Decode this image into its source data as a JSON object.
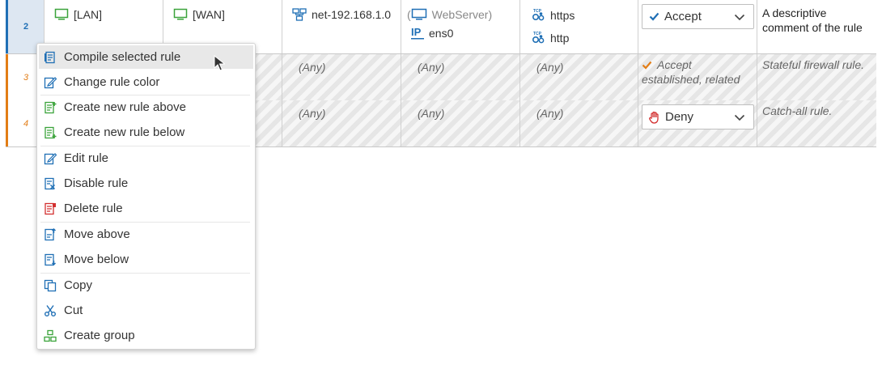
{
  "rows": [
    {
      "num": "2",
      "source": "[LAN]",
      "destination": "[WAN]",
      "network": "net-192.168.1.0",
      "host_prefix": "(",
      "host": "WebServer)",
      "interface": "ens0",
      "services": [
        "https",
        "http"
      ],
      "action": "Accept",
      "comment": "A descriptive comment of the rule"
    },
    {
      "num": "3",
      "any": [
        "(Any)",
        "(Any)",
        "(Any)"
      ],
      "action_line1": "Accept",
      "action_line2": "established, related",
      "comment": "Stateful firewall rule."
    },
    {
      "num": "4",
      "any": [
        "(Any)",
        "(Any)",
        "(Any)"
      ],
      "action": "Deny",
      "comment": "Catch-all rule."
    }
  ],
  "context_menu": {
    "items": [
      {
        "label": "Compile selected rule",
        "icon": "compile-icon"
      },
      {
        "label": "Change rule color",
        "icon": "edit-color-icon"
      },
      {
        "label": "Create new rule above",
        "icon": "rule-add-above-icon"
      },
      {
        "label": "Create new rule below",
        "icon": "rule-add-below-icon"
      },
      {
        "label": "Edit rule",
        "icon": "edit-icon"
      },
      {
        "label": "Disable rule",
        "icon": "disable-icon"
      },
      {
        "label": "Delete rule",
        "icon": "delete-icon"
      },
      {
        "label": "Move above",
        "icon": "move-up-icon"
      },
      {
        "label": "Move below",
        "icon": "move-down-icon"
      },
      {
        "label": "Copy",
        "icon": "copy-icon"
      },
      {
        "label": "Cut",
        "icon": "scissors-icon"
      },
      {
        "label": "Create group",
        "icon": "group-icon"
      }
    ]
  },
  "colors": {
    "selected_row_accent": "#1f6fb5",
    "row_accent": "#e27d16",
    "accept": "#1f6fb5",
    "deny": "#d32f2f",
    "icon_blue": "#1f6fb5",
    "icon_green": "#3aa33a",
    "icon_red": "#d32f2f"
  }
}
